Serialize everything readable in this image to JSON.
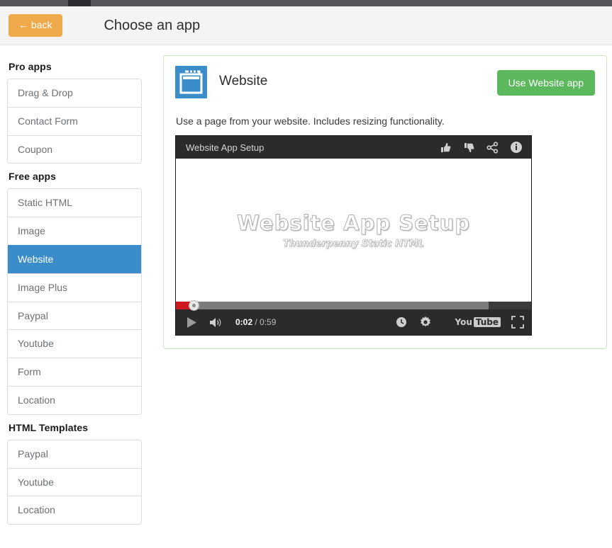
{
  "header": {
    "back_label": "← back",
    "title": "Choose an app"
  },
  "sidebar": {
    "groups": [
      {
        "heading": "Pro apps",
        "items": [
          {
            "label": "Drag & Drop",
            "active": false
          },
          {
            "label": "Contact Form",
            "active": false
          },
          {
            "label": "Coupon",
            "active": false
          }
        ]
      },
      {
        "heading": "Free apps",
        "items": [
          {
            "label": "Static HTML",
            "active": false
          },
          {
            "label": "Image",
            "active": false
          },
          {
            "label": "Website",
            "active": true
          },
          {
            "label": "Image Plus",
            "active": false
          },
          {
            "label": "Paypal",
            "active": false
          },
          {
            "label": "Youtube",
            "active": false
          },
          {
            "label": "Form",
            "active": false
          },
          {
            "label": "Location",
            "active": false
          }
        ]
      },
      {
        "heading": "HTML Templates",
        "items": [
          {
            "label": "Paypal",
            "active": false
          },
          {
            "label": "Youtube",
            "active": false
          },
          {
            "label": "Location",
            "active": false
          }
        ]
      }
    ]
  },
  "app_panel": {
    "app_name": "Website",
    "use_app_button": "Use Website app",
    "description": "Use a page from your website. Includes resizing functionality.",
    "icon_name": "website-window-icon",
    "accent_border_color": "#c8e6c1"
  },
  "video": {
    "title": "Website App Setup",
    "watermark_title": "Website App Setup",
    "watermark_subtitle": "Thunderpenny Static HTML",
    "current_time": "0:02",
    "duration": "/ 0:59",
    "played_percent": 5,
    "loaded_percent": 88,
    "titlebar_icons": [
      "thumbs-up-icon",
      "thumbs-down-icon",
      "share-icon",
      "info-icon"
    ],
    "control_icons": [
      "play-icon",
      "volume-icon",
      "watch-later-icon",
      "settings-gear-icon",
      "fullscreen-icon"
    ],
    "brand_you": "You",
    "brand_tube": "Tube"
  },
  "colors": {
    "back_button": "#efa94a",
    "use_app_button": "#5cb85c",
    "active_item": "#3a8dc8",
    "app_icon": "#3a8dc8",
    "progress_played": "#cc181e"
  }
}
